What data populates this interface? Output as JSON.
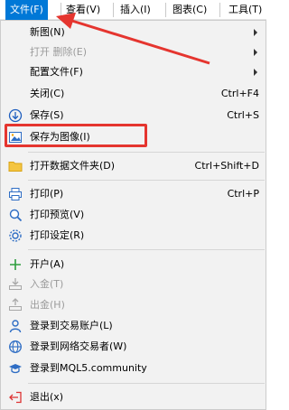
{
  "menubar": {
    "items": [
      {
        "label": "文件(F)",
        "active": true
      },
      {
        "label": "查看(V)"
      },
      {
        "label": "插入(I)"
      },
      {
        "label": "图表(C)"
      },
      {
        "label": "工具(T)"
      }
    ]
  },
  "file_menu": {
    "items": [
      {
        "label": "新图(N)",
        "submenu": true
      },
      {
        "label": "打开 删除(E)",
        "submenu": true,
        "disabled": true
      },
      {
        "label": "配置文件(F)",
        "submenu": true
      },
      {
        "label": "关闭(C)",
        "shortcut": "Ctrl+F4"
      },
      {
        "label": "保存(S)",
        "shortcut": "Ctrl+S",
        "icon": "save-icon"
      },
      {
        "label": "保存为图像(I)",
        "icon": "save-image-icon",
        "highlighted": true
      },
      {
        "label": "打开数据文件夹(D)",
        "shortcut": "Ctrl+Shift+D",
        "icon": "folder-icon"
      },
      {
        "label": "打印(P)",
        "shortcut": "Ctrl+P",
        "icon": "printer-icon"
      },
      {
        "label": "打印预览(V)",
        "icon": "print-preview-icon"
      },
      {
        "label": "打印设定(R)",
        "icon": "print-settings-icon"
      },
      {
        "label": "开户(A)",
        "icon": "plus-icon"
      },
      {
        "label": "入金(T)",
        "icon": "deposit-icon",
        "disabled": true
      },
      {
        "label": "出金(H)",
        "icon": "withdraw-icon",
        "disabled": true
      },
      {
        "label": "登录到交易账户(L)",
        "icon": "user-icon"
      },
      {
        "label": "登录到网络交易者(W)",
        "icon": "globe-icon"
      },
      {
        "label": "登录到MQL5.community",
        "icon": "graduation-cap-icon"
      },
      {
        "label": "退出(x)",
        "icon": "exit-icon"
      }
    ]
  },
  "colors": {
    "accent": "#0078d7",
    "annotation": "#e5352f",
    "menu_bg": "#f2f2f2",
    "disabled_text": "#9b9b9b"
  }
}
